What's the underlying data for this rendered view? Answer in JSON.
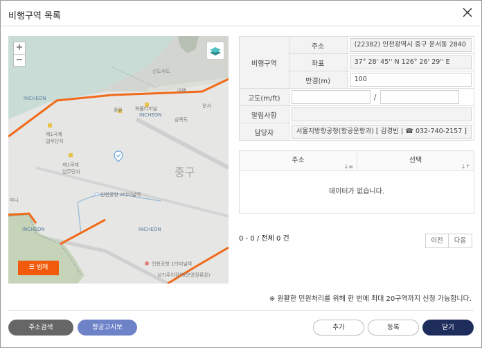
{
  "dialog": {
    "title": "비행구역 목록"
  },
  "map": {
    "zoom_in": "+",
    "zoom_out": "−",
    "legend_label": "범례",
    "labels": {
      "l1": "신도수도",
      "l2": "INCHEON",
      "l3": "중유",
      "l4": "화물터미널",
      "l5": "INCHEON",
      "l6": "운서",
      "l7": "삼목도",
      "l8": "제1국제 업무단지",
      "l9": "제1국제 업무단지",
      "l10": "중구",
      "l11": "인천공항 2터미널역",
      "l12": "INCHEON",
      "l13": "INCHEON",
      "l14": "인천공항 1터미널역",
      "l15": "상가주차장역(운영정류장)",
      "l16": "아랫",
      "l17": "마니"
    }
  },
  "info": {
    "zone_label": "비행구역",
    "address_label": "주소",
    "address_value": "(22382) 인천광역시 중구 운서동 2840",
    "coord_label": "좌표",
    "coord_value": "37° 28' 45'' N 126° 26' 29'' E",
    "radius_label": "반경(m)",
    "radius_value": "100",
    "altitude_label": "고도(m/ft)",
    "altitude_sep": "/",
    "notice_label": "알림사항",
    "manager_label": "담당자",
    "manager_value": "서울지방항공청(항공운항과) [ 김경빈 | ☎ 032-740-2157 ]"
  },
  "grid": {
    "col_address": "주소",
    "col_select": "선택",
    "sort_icon_1": "↓≡",
    "sort_icon_2": "↓↑",
    "empty": "데이터가 없습니다."
  },
  "paging": {
    "count": "0 - 0 / 전체 0 건",
    "prev": "이전",
    "next": "다음"
  },
  "notice": "※ 원활한 민원처리를 위해 한 번에 최대 20구역까지 신청 가능합니다.",
  "buttons": {
    "address_search": "주소검색",
    "aviation_notice": "항공고시보",
    "add": "추가",
    "register": "등록",
    "close": "닫기"
  },
  "colors": {
    "accent_orange": "#f05a0a",
    "navy": "#1f2d5c",
    "blue": "#6e82c8"
  }
}
